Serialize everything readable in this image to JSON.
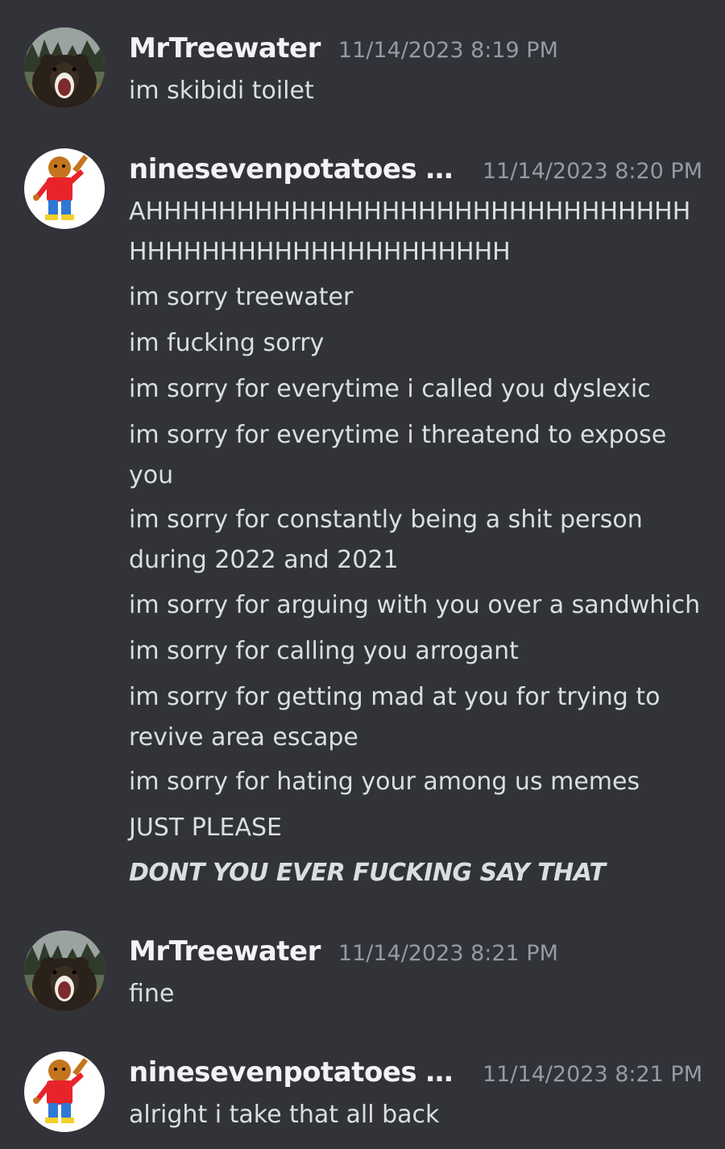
{
  "messages": [
    {
      "username": "MrTreewater",
      "timestamp": "11/14/2023 8:19 PM",
      "lines": [
        "im skibidi toilet"
      ]
    },
    {
      "username": "ninesevenpotatoes (no...",
      "timestamp": "11/14/2023 8:20 PM",
      "lines": [
        "AHHHHHHHHHHHHHHHHHHHHHHHHHHHHHHHHHHHHHHHHHHHHHHHHHHH",
        "im sorry treewater",
        "im fucking sorry",
        "im sorry for everytime i called you dyslexic",
        "im sorry for everytime i threatend to expose you",
        "im sorry for constantly being a shit person during 2022 and 2021",
        "im sorry for arguing with you over a sandwhich",
        "im sorry for calling you arrogant",
        "im sorry for getting mad at you for trying to revive area escape",
        "im sorry for hating your among us memes",
        "JUST PLEASE",
        "DONT YOU EVER FUCKING SAY THAT"
      ]
    },
    {
      "username": "MrTreewater",
      "timestamp": "11/14/2023 8:21 PM",
      "lines": [
        "fine"
      ]
    },
    {
      "username": "ninesevenpotatoes (not...",
      "timestamp": "11/14/2023 8:21 PM",
      "lines": [
        "alright i take that all back"
      ]
    }
  ],
  "avatars": {
    "treewater": "bear-avatar",
    "potatoes": "cartoon-character-avatar"
  },
  "colors": {
    "background": "#313338",
    "username": "#f2f3f5",
    "timestamp": "#949ba4",
    "text": "#dbdee1"
  }
}
